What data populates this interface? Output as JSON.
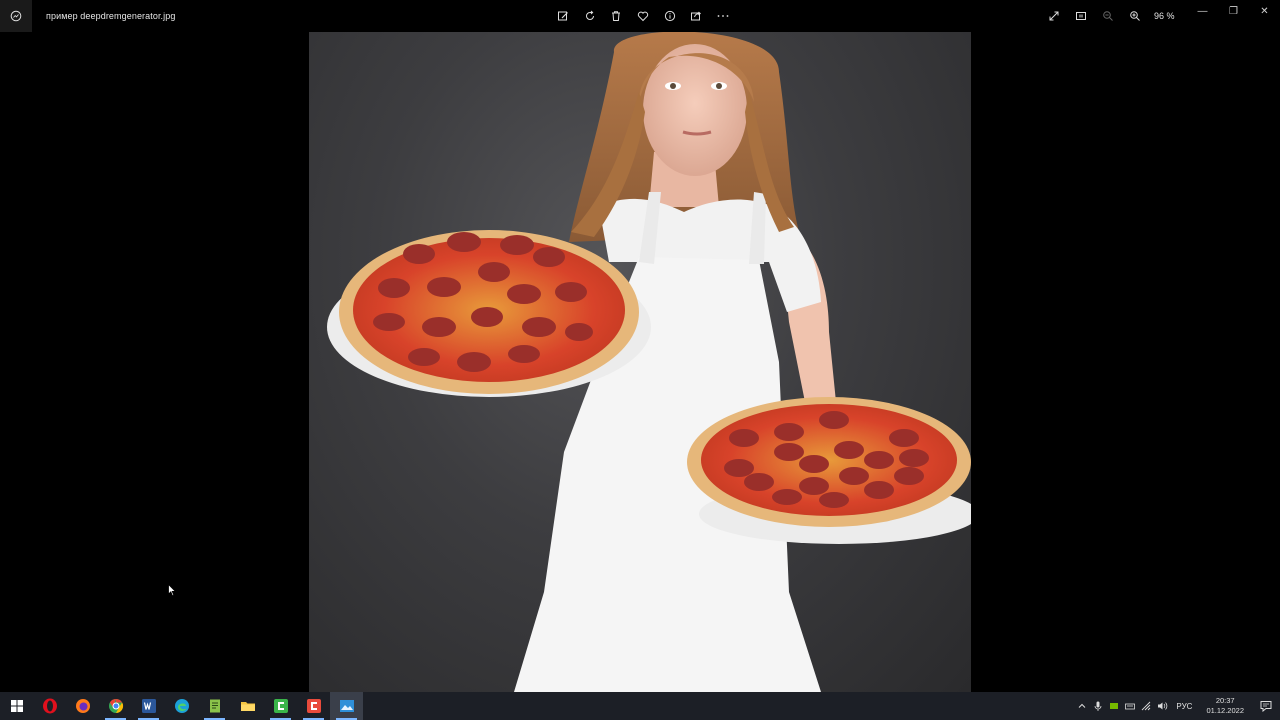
{
  "window": {
    "filename": "пример deepdremgenerator.jpg",
    "zoom_label": "96 %",
    "toolbar_icons": [
      "edit-image-icon",
      "rotate-icon",
      "delete-icon",
      "favorite-icon",
      "info-icon",
      "share-icon",
      "more-icon"
    ],
    "right_icons": [
      "fullscreen-icon",
      "slideshow-icon",
      "zoom-out-icon",
      "zoom-in-icon"
    ],
    "controls": {
      "minimize": "—",
      "restore": "❐",
      "close": "✕"
    }
  },
  "taskbar": {
    "apps": [
      {
        "name": "start-button",
        "icon": "windows-logo-icon"
      },
      {
        "name": "opera-app",
        "icon": "opera-icon",
        "color": "#e0101d"
      },
      {
        "name": "firefox-app",
        "icon": "firefox-icon",
        "color": "#ff7a1a"
      },
      {
        "name": "chrome-app",
        "icon": "chrome-icon",
        "color": "#34a853"
      },
      {
        "name": "word-app",
        "icon": "word-icon",
        "color": "#2b579a"
      },
      {
        "name": "edge-app",
        "icon": "edge-icon",
        "color": "#1ca0d8"
      },
      {
        "name": "notepad-app",
        "icon": "notepad-icon",
        "color": "#8bc34a"
      },
      {
        "name": "explorer-app",
        "icon": "folder-icon",
        "color": "#f4c542"
      },
      {
        "name": "camtasia-app",
        "icon": "camtasia-icon",
        "color": "#3ab54a"
      },
      {
        "name": "recorder-app",
        "icon": "recorder-icon",
        "color": "#e94b3c"
      },
      {
        "name": "photos-app",
        "icon": "photos-icon",
        "color": "#2f8fd8"
      }
    ],
    "language": "РУС",
    "time": "20:37",
    "date": "01.12.2022"
  }
}
